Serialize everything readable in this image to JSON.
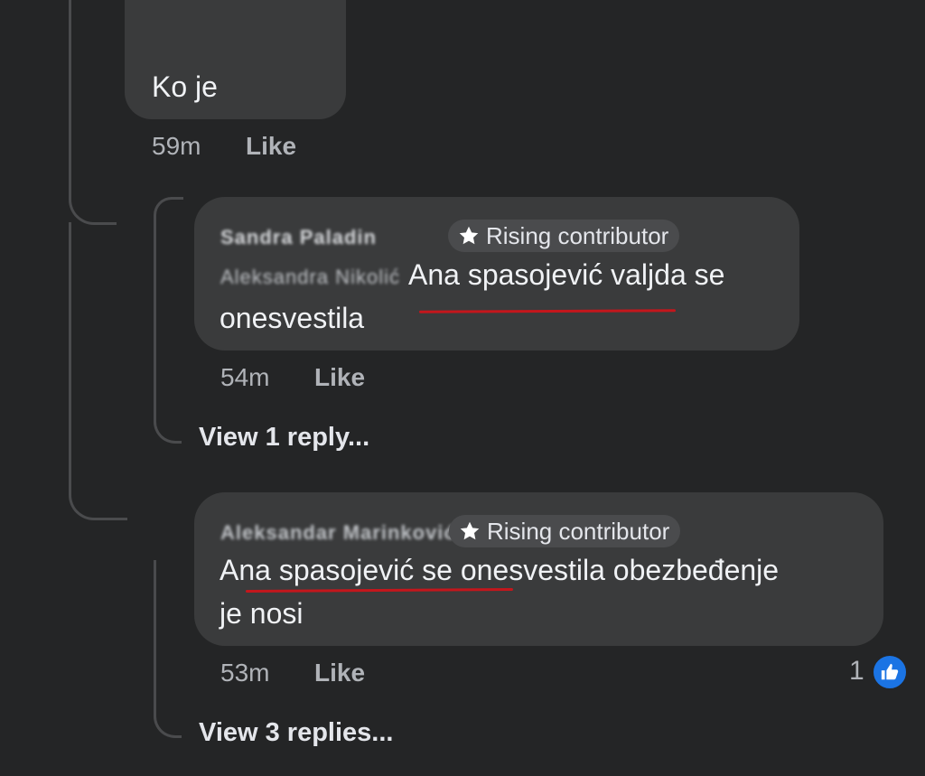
{
  "comments": [
    {
      "text": "Ko je",
      "time": "59m",
      "like_label": "Like"
    },
    {
      "author": "Sandra Paladin",
      "badge": "Rising contributor",
      "mention": "Aleksandra Nikolić",
      "text_line1": "Ana  spasojević valjda se",
      "text_line2": "onesvestila",
      "time": "54m",
      "like_label": "Like",
      "view_replies": "View 1 reply..."
    },
    {
      "author": "Aleksandar Marinković",
      "badge": "Rising contributor",
      "text_line1": "Ana spasojević se onesvestila obezbeđenje",
      "text_line2": "je nosi",
      "time": "53m",
      "like_label": "Like",
      "reaction_count": "1",
      "view_replies": "View 3 replies..."
    }
  ],
  "icons": {
    "badge_icon": "star-icon",
    "reaction_icon": "thumbs-up-icon"
  },
  "colors": {
    "background": "#242526",
    "bubble": "#3a3b3c",
    "badge_bg": "#4a4b4d",
    "like_blue": "#1b74e4",
    "annotation_red": "#c4161c"
  }
}
